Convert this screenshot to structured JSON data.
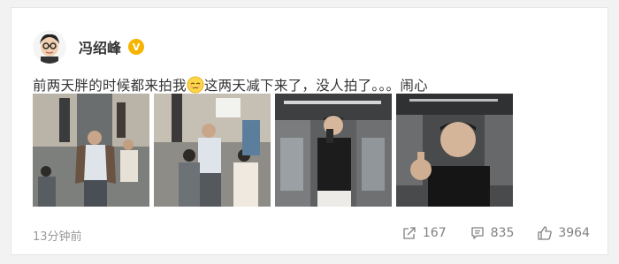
{
  "user": {
    "name": "冯绍峰",
    "verified_badge": "V"
  },
  "post": {
    "text_before_emoji": "前两天胖的时候都来拍我",
    "emoji": "sleepy-face",
    "text_after_emoji": "这两天减下来了，没人拍了。。。闹心",
    "photos": [
      "photo-1",
      "photo-2",
      "photo-3",
      "photo-4"
    ]
  },
  "footer": {
    "time": "13分钟前",
    "repost_count": "167",
    "comment_count": "835",
    "like_count": "3964"
  },
  "colors": {
    "badge": "#f5b500",
    "muted": "#999999",
    "text": "#333333"
  }
}
